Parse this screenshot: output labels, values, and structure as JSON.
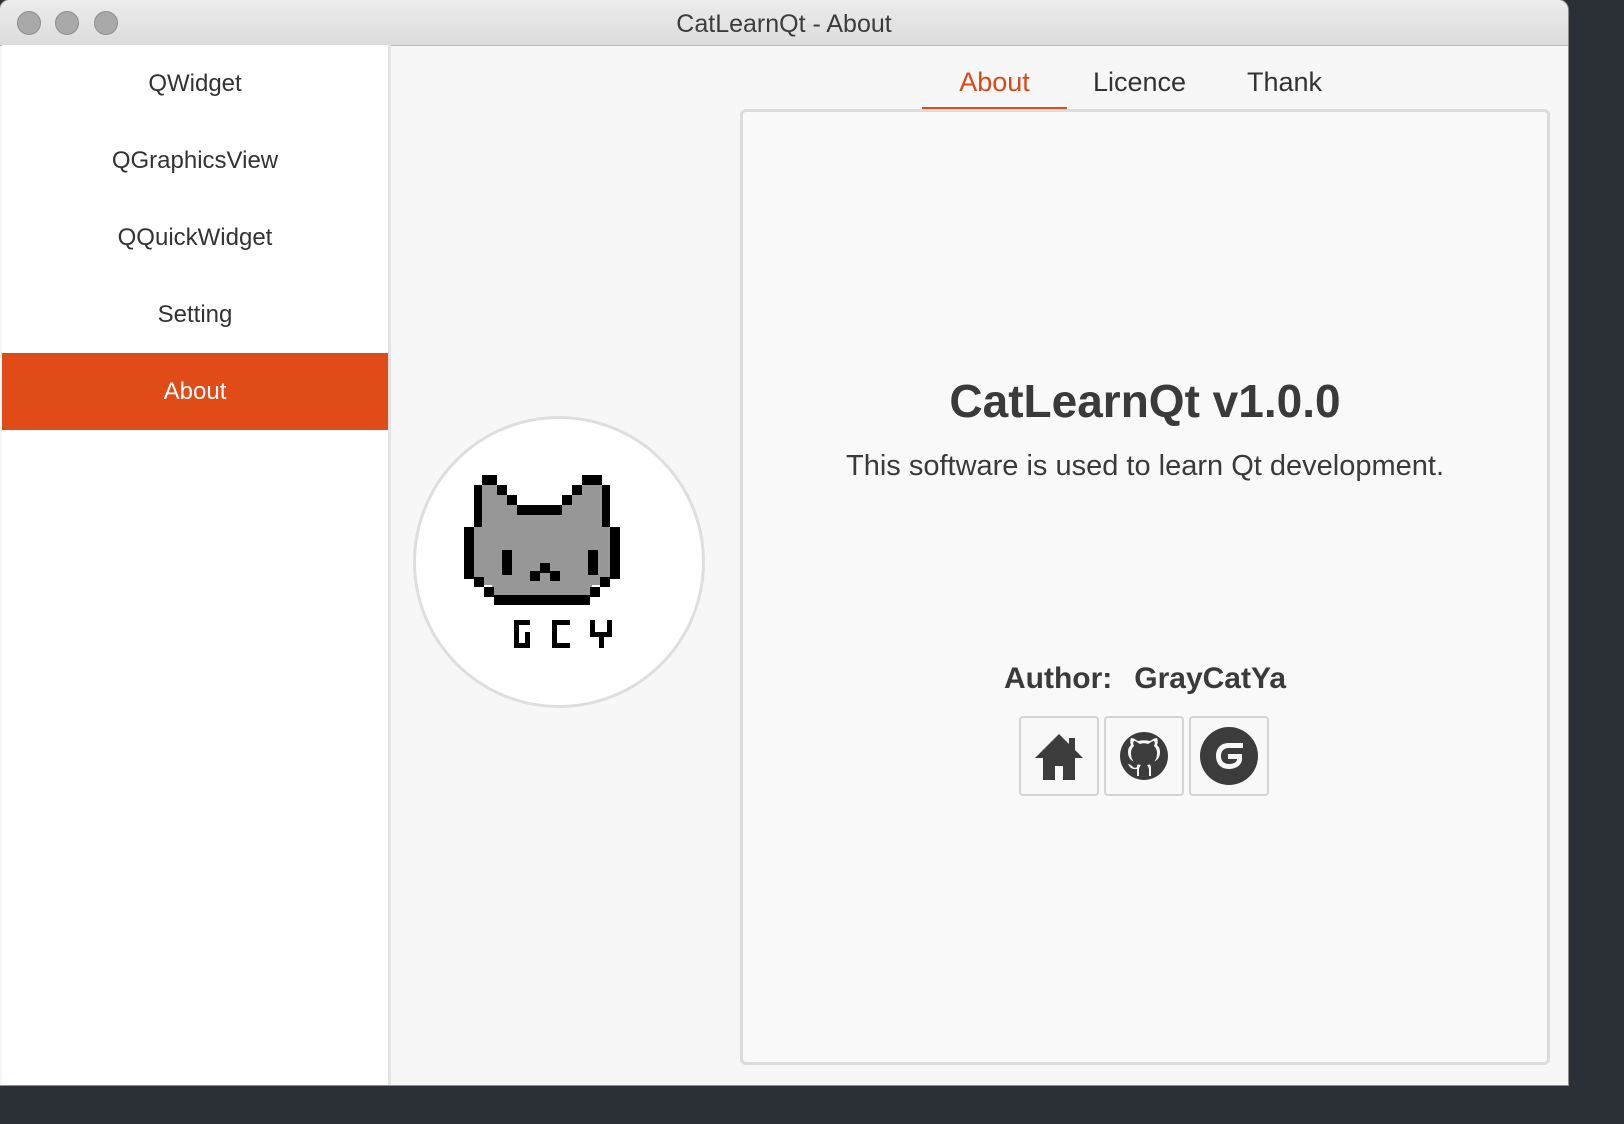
{
  "window": {
    "title": "CatLearnQt - About"
  },
  "sidebar": {
    "items": [
      {
        "label": "QWidget"
      },
      {
        "label": "QGraphicsView"
      },
      {
        "label": "QQuickWidget"
      },
      {
        "label": "Setting"
      },
      {
        "label": "About",
        "active": true
      }
    ]
  },
  "tabs": [
    {
      "label": "About",
      "active": true
    },
    {
      "label": "Licence"
    },
    {
      "label": "Thank"
    }
  ],
  "about": {
    "title": "CatLearnQt  v1.0.0",
    "description": "This software is used to learn Qt development.",
    "author_label": "Author:",
    "author_name": "GrayCatYa",
    "links": [
      {
        "icon": "home-icon"
      },
      {
        "icon": "github-icon"
      },
      {
        "icon": "gitee-icon"
      }
    ]
  },
  "logo": {
    "text": "GCY"
  },
  "colors": {
    "accent": "#e04b18",
    "text": "#3a3a3a"
  }
}
